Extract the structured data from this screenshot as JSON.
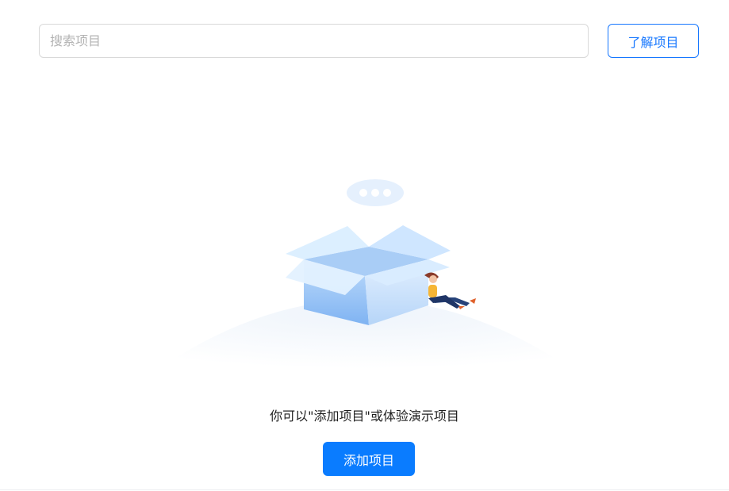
{
  "search": {
    "placeholder": "搜索项目",
    "value": ""
  },
  "header": {
    "learn_button_label": "了解项目"
  },
  "empty_state": {
    "hint": "你可以\"添加项目\"或体验演示项目",
    "add_button_label": "添加项目"
  },
  "icons": {
    "illustration": "empty-box-illustration",
    "speech": "speech-bubble-icon"
  },
  "colors": {
    "primary": "#0a7cff",
    "outline": "#1677ff",
    "box_light": "#dcefff",
    "box_dark": "#7fb3f2"
  }
}
